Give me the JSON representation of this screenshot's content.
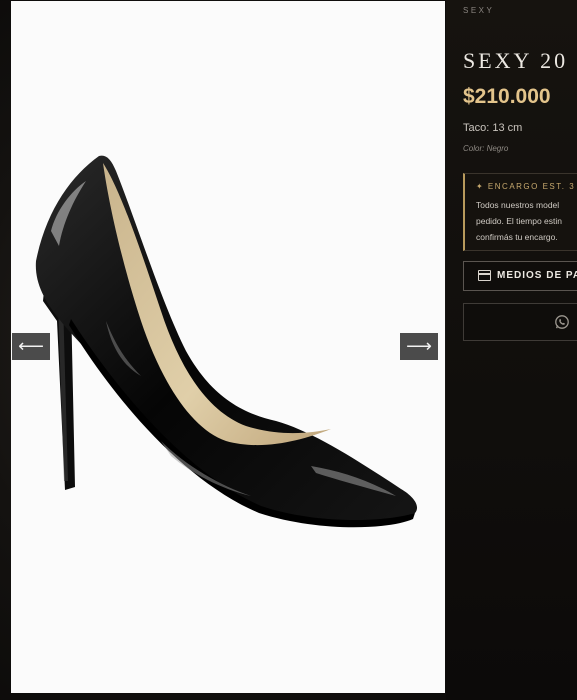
{
  "product": {
    "brand": "SEXY",
    "title": "SEXY 20",
    "price": "$210.000",
    "heel": "Taco: 13 cm",
    "color": "Color: Negro"
  },
  "notice": {
    "heading": "✦ ENCARGO EST. 3",
    "lines": [
      "Todos nuestros model",
      "pedido. El tiempo estin",
      "confirmás tu encargo."
    ]
  },
  "buttons": {
    "payment_label": "MEDIOS DE PA",
    "prev_arrow": "⟵",
    "next_arrow": "⟶"
  },
  "icons": {
    "payment": "card-icon",
    "whatsapp": "whatsapp-icon",
    "prev": "arrow-left-icon",
    "next": "arrow-right-icon"
  },
  "colors": {
    "accent_gold": "#e3c48b",
    "panel_bg": "#100e0c"
  }
}
